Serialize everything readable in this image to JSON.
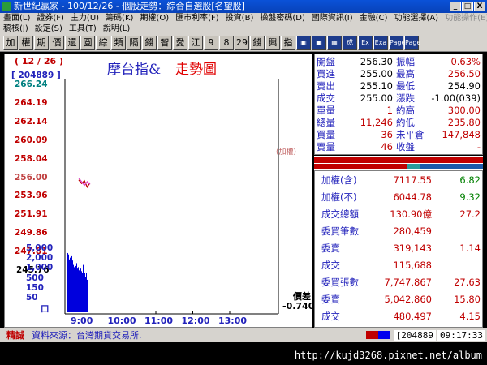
{
  "window": {
    "title": "新世紀贏家 - 100/12/26 - 個股走勢：綜合自選股[名望股]",
    "min_label": "_",
    "max_label": "□",
    "close_label": "X"
  },
  "menu": {
    "row1": [
      "畫面(L)",
      "證券(F)",
      "主力(U)",
      "籌碼(K)",
      "期權(O)",
      "匯市利率(F)",
      "投資(B)",
      "操盤密碼(D)",
      "國際資訊(I)",
      "金融(C)",
      "功能選擇(A)",
      "功能操作(E)"
    ],
    "row1_disabled_index": 11,
    "row2": [
      "稿核(J)",
      "設定(S)",
      "工具(T)",
      "說明(L)"
    ]
  },
  "toolbar": {
    "buttons": [
      "加",
      "權",
      "期",
      "價",
      "還",
      "圓",
      "綜",
      "類",
      "隔",
      "錢",
      "智",
      "愛",
      "江",
      "9",
      "8",
      "29",
      "錢",
      "興",
      "指",
      "▣",
      "▣",
      "▦",
      "成",
      "Ex",
      "Exa",
      "Page",
      "Page"
    ]
  },
  "chart": {
    "date_label": "( 12 / 26 )",
    "code_label": "[ 204889 ]",
    "title_a": "摩台指&",
    "title_b": "走勢圖",
    "ref_label": "(加權)",
    "spread_label": "價差",
    "spread_value": "-0.740"
  },
  "chart_data": {
    "type": "line",
    "x": [
      "9:00",
      "9:05",
      "9:10",
      "9:15",
      "9:20"
    ],
    "x_ticks": [
      "9:00",
      "10:00",
      "11:00",
      "12:00",
      "13:00"
    ],
    "y_ticks": [
      "266.24",
      "264.19",
      "262.14",
      "260.09",
      "258.04",
      "256.00",
      "253.96",
      "251.91",
      "249.86",
      "247.81",
      "245.76"
    ],
    "y_range": [
      245.76,
      266.24
    ],
    "reference_value": 256.0,
    "series": [
      {
        "values": [
          255.8,
          255.4,
          255.7,
          255.0,
          255.5
        ],
        "color": "#c00000"
      },
      {
        "values": [
          256.0,
          255.6,
          255.2,
          255.6,
          255.3
        ],
        "color": "#dd44cc"
      }
    ],
    "volume_ticks": [
      "5,000",
      "2,000",
      "1,000",
      "500",
      "150",
      "50",
      "口"
    ],
    "volume_values": [
      5000,
      1800,
      1500,
      800,
      1000,
      500,
      1200,
      700,
      400,
      300,
      900,
      350,
      500,
      250,
      300,
      200,
      600,
      250,
      180,
      150,
      400,
      120,
      150,
      90,
      150,
      60,
      120
    ]
  },
  "quote": {
    "rows": [
      {
        "l1": "開盤",
        "v1": "256.30",
        "l2": "振幅",
        "v2": "0.63%",
        "c1": "#000000",
        "c2": "#c00000"
      },
      {
        "l1": "買進",
        "v1": "255.00",
        "l2": "最高",
        "v2": "256.50",
        "c1": "#000000",
        "c2": "#c00000"
      },
      {
        "l1": "賣出",
        "v1": "255.10",
        "l2": "最低",
        "v2": "254.90",
        "c1": "#000000",
        "c2": "#000000"
      },
      {
        "l1": "成交",
        "v1": "255.00",
        "l2": "漲跌",
        "v2": "-1.00(039)",
        "c1": "#000000",
        "c2": "#000000"
      },
      {
        "l1": "單量",
        "v1": "1",
        "l2": "約高",
        "v2": "300.00",
        "c1": "#c00000",
        "c2": "#c00000"
      },
      {
        "l1": "總量",
        "v1": "11,246",
        "l2": "約低",
        "v2": "235.80",
        "c1": "#c00000",
        "c2": "#c00000"
      },
      {
        "l1": "買量",
        "v1": "36",
        "l2": "未平倉",
        "v2": "147,848",
        "c1": "#c00000",
        "c2": "#c00000"
      },
      {
        "l1": "賣量",
        "v1": "46",
        "l2": "收盤",
        "v2": "-",
        "c1": "#c00000",
        "c2": "#c00000"
      }
    ]
  },
  "colorbar": {
    "red_fraction": 0.55
  },
  "indices": {
    "rows": [
      {
        "label": "加權(含)",
        "value": "7117.55",
        "extra": "6.82",
        "vcolor": "#c00000",
        "ecolor": "#008000"
      },
      {
        "label": "加權(不)",
        "value": "6044.78",
        "extra": "9.32",
        "vcolor": "#c00000",
        "ecolor": "#008000"
      },
      {
        "label": "成交總額",
        "value": "130.90億",
        "extra": "27.2",
        "vcolor": "#c00000",
        "ecolor": "#c00000"
      },
      {
        "label": "委買筆數",
        "value": "280,459",
        "extra": "",
        "vcolor": "#c00000",
        "ecolor": "#c00000"
      },
      {
        "label": "委賣",
        "value": "319,143",
        "extra": "1.14",
        "vcolor": "#c00000",
        "ecolor": "#c00000"
      },
      {
        "label": "成交",
        "value": "115,688",
        "extra": "",
        "vcolor": "#c00000",
        "ecolor": "#c00000"
      },
      {
        "label": "委買張數",
        "value": "7,747,867",
        "extra": "27.63",
        "vcolor": "#c00000",
        "ecolor": "#c00000"
      },
      {
        "label": "委賣",
        "value": "5,042,860",
        "extra": "15.80",
        "vcolor": "#c00000",
        "ecolor": "#c00000"
      },
      {
        "label": "成交",
        "value": "480,497",
        "extra": "4.15",
        "vcolor": "#c00000",
        "ecolor": "#c00000"
      }
    ]
  },
  "status": {
    "mode": "精誠",
    "source": "資料來源：台灣期貨交易所.",
    "code": "[204889",
    "time": "09:17:33"
  },
  "footer": {
    "url": "http://kujd3268.pixnet.net/album"
  }
}
